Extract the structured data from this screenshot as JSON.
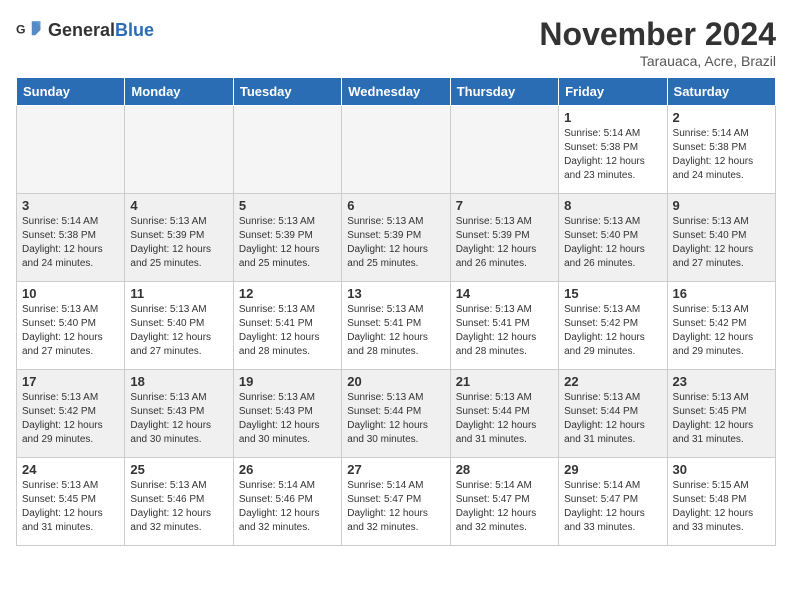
{
  "header": {
    "logo_general": "General",
    "logo_blue": "Blue",
    "month_year": "November 2024",
    "location": "Tarauaca, Acre, Brazil"
  },
  "days_of_week": [
    "Sunday",
    "Monday",
    "Tuesday",
    "Wednesday",
    "Thursday",
    "Friday",
    "Saturday"
  ],
  "weeks": [
    [
      {
        "day": "",
        "empty": true
      },
      {
        "day": "",
        "empty": true
      },
      {
        "day": "",
        "empty": true
      },
      {
        "day": "",
        "empty": true
      },
      {
        "day": "",
        "empty": true
      },
      {
        "day": "1",
        "sunrise": "Sunrise: 5:14 AM",
        "sunset": "Sunset: 5:38 PM",
        "daylight": "Daylight: 12 hours and 23 minutes."
      },
      {
        "day": "2",
        "sunrise": "Sunrise: 5:14 AM",
        "sunset": "Sunset: 5:38 PM",
        "daylight": "Daylight: 12 hours and 24 minutes."
      }
    ],
    [
      {
        "day": "3",
        "sunrise": "Sunrise: 5:14 AM",
        "sunset": "Sunset: 5:38 PM",
        "daylight": "Daylight: 12 hours and 24 minutes."
      },
      {
        "day": "4",
        "sunrise": "Sunrise: 5:13 AM",
        "sunset": "Sunset: 5:39 PM",
        "daylight": "Daylight: 12 hours and 25 minutes."
      },
      {
        "day": "5",
        "sunrise": "Sunrise: 5:13 AM",
        "sunset": "Sunset: 5:39 PM",
        "daylight": "Daylight: 12 hours and 25 minutes."
      },
      {
        "day": "6",
        "sunrise": "Sunrise: 5:13 AM",
        "sunset": "Sunset: 5:39 PM",
        "daylight": "Daylight: 12 hours and 25 minutes."
      },
      {
        "day": "7",
        "sunrise": "Sunrise: 5:13 AM",
        "sunset": "Sunset: 5:39 PM",
        "daylight": "Daylight: 12 hours and 26 minutes."
      },
      {
        "day": "8",
        "sunrise": "Sunrise: 5:13 AM",
        "sunset": "Sunset: 5:40 PM",
        "daylight": "Daylight: 12 hours and 26 minutes."
      },
      {
        "day": "9",
        "sunrise": "Sunrise: 5:13 AM",
        "sunset": "Sunset: 5:40 PM",
        "daylight": "Daylight: 12 hours and 27 minutes."
      }
    ],
    [
      {
        "day": "10",
        "sunrise": "Sunrise: 5:13 AM",
        "sunset": "Sunset: 5:40 PM",
        "daylight": "Daylight: 12 hours and 27 minutes."
      },
      {
        "day": "11",
        "sunrise": "Sunrise: 5:13 AM",
        "sunset": "Sunset: 5:40 PM",
        "daylight": "Daylight: 12 hours and 27 minutes."
      },
      {
        "day": "12",
        "sunrise": "Sunrise: 5:13 AM",
        "sunset": "Sunset: 5:41 PM",
        "daylight": "Daylight: 12 hours and 28 minutes."
      },
      {
        "day": "13",
        "sunrise": "Sunrise: 5:13 AM",
        "sunset": "Sunset: 5:41 PM",
        "daylight": "Daylight: 12 hours and 28 minutes."
      },
      {
        "day": "14",
        "sunrise": "Sunrise: 5:13 AM",
        "sunset": "Sunset: 5:41 PM",
        "daylight": "Daylight: 12 hours and 28 minutes."
      },
      {
        "day": "15",
        "sunrise": "Sunrise: 5:13 AM",
        "sunset": "Sunset: 5:42 PM",
        "daylight": "Daylight: 12 hours and 29 minutes."
      },
      {
        "day": "16",
        "sunrise": "Sunrise: 5:13 AM",
        "sunset": "Sunset: 5:42 PM",
        "daylight": "Daylight: 12 hours and 29 minutes."
      }
    ],
    [
      {
        "day": "17",
        "sunrise": "Sunrise: 5:13 AM",
        "sunset": "Sunset: 5:42 PM",
        "daylight": "Daylight: 12 hours and 29 minutes."
      },
      {
        "day": "18",
        "sunrise": "Sunrise: 5:13 AM",
        "sunset": "Sunset: 5:43 PM",
        "daylight": "Daylight: 12 hours and 30 minutes."
      },
      {
        "day": "19",
        "sunrise": "Sunrise: 5:13 AM",
        "sunset": "Sunset: 5:43 PM",
        "daylight": "Daylight: 12 hours and 30 minutes."
      },
      {
        "day": "20",
        "sunrise": "Sunrise: 5:13 AM",
        "sunset": "Sunset: 5:44 PM",
        "daylight": "Daylight: 12 hours and 30 minutes."
      },
      {
        "day": "21",
        "sunrise": "Sunrise: 5:13 AM",
        "sunset": "Sunset: 5:44 PM",
        "daylight": "Daylight: 12 hours and 31 minutes."
      },
      {
        "day": "22",
        "sunrise": "Sunrise: 5:13 AM",
        "sunset": "Sunset: 5:44 PM",
        "daylight": "Daylight: 12 hours and 31 minutes."
      },
      {
        "day": "23",
        "sunrise": "Sunrise: 5:13 AM",
        "sunset": "Sunset: 5:45 PM",
        "daylight": "Daylight: 12 hours and 31 minutes."
      }
    ],
    [
      {
        "day": "24",
        "sunrise": "Sunrise: 5:13 AM",
        "sunset": "Sunset: 5:45 PM",
        "daylight": "Daylight: 12 hours and 31 minutes."
      },
      {
        "day": "25",
        "sunrise": "Sunrise: 5:13 AM",
        "sunset": "Sunset: 5:46 PM",
        "daylight": "Daylight: 12 hours and 32 minutes."
      },
      {
        "day": "26",
        "sunrise": "Sunrise: 5:14 AM",
        "sunset": "Sunset: 5:46 PM",
        "daylight": "Daylight: 12 hours and 32 minutes."
      },
      {
        "day": "27",
        "sunrise": "Sunrise: 5:14 AM",
        "sunset": "Sunset: 5:47 PM",
        "daylight": "Daylight: 12 hours and 32 minutes."
      },
      {
        "day": "28",
        "sunrise": "Sunrise: 5:14 AM",
        "sunset": "Sunset: 5:47 PM",
        "daylight": "Daylight: 12 hours and 32 minutes."
      },
      {
        "day": "29",
        "sunrise": "Sunrise: 5:14 AM",
        "sunset": "Sunset: 5:47 PM",
        "daylight": "Daylight: 12 hours and 33 minutes."
      },
      {
        "day": "30",
        "sunrise": "Sunrise: 5:15 AM",
        "sunset": "Sunset: 5:48 PM",
        "daylight": "Daylight: 12 hours and 33 minutes."
      }
    ]
  ]
}
